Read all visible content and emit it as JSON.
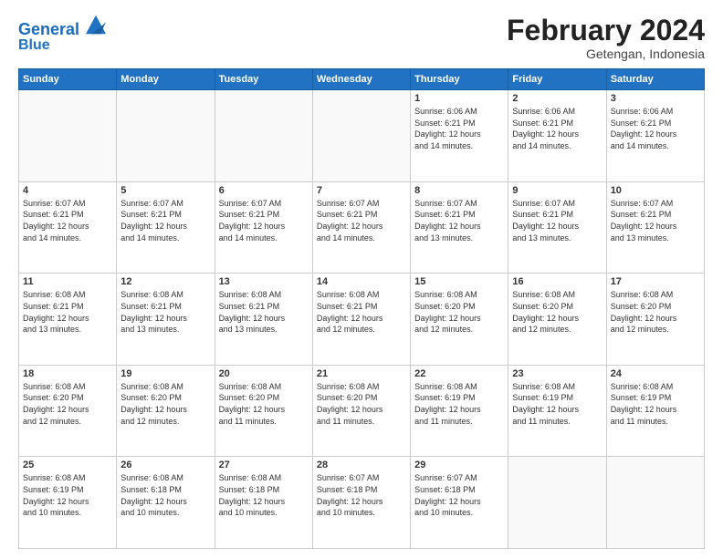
{
  "header": {
    "logo_line1": "General",
    "logo_line2": "Blue",
    "month_year": "February 2024",
    "location": "Getengan, Indonesia"
  },
  "days_of_week": [
    "Sunday",
    "Monday",
    "Tuesday",
    "Wednesday",
    "Thursday",
    "Friday",
    "Saturday"
  ],
  "weeks": [
    [
      {
        "day": "",
        "info": ""
      },
      {
        "day": "",
        "info": ""
      },
      {
        "day": "",
        "info": ""
      },
      {
        "day": "",
        "info": ""
      },
      {
        "day": "1",
        "info": "Sunrise: 6:06 AM\nSunset: 6:21 PM\nDaylight: 12 hours\nand 14 minutes."
      },
      {
        "day": "2",
        "info": "Sunrise: 6:06 AM\nSunset: 6:21 PM\nDaylight: 12 hours\nand 14 minutes."
      },
      {
        "day": "3",
        "info": "Sunrise: 6:06 AM\nSunset: 6:21 PM\nDaylight: 12 hours\nand 14 minutes."
      }
    ],
    [
      {
        "day": "4",
        "info": "Sunrise: 6:07 AM\nSunset: 6:21 PM\nDaylight: 12 hours\nand 14 minutes."
      },
      {
        "day": "5",
        "info": "Sunrise: 6:07 AM\nSunset: 6:21 PM\nDaylight: 12 hours\nand 14 minutes."
      },
      {
        "day": "6",
        "info": "Sunrise: 6:07 AM\nSunset: 6:21 PM\nDaylight: 12 hours\nand 14 minutes."
      },
      {
        "day": "7",
        "info": "Sunrise: 6:07 AM\nSunset: 6:21 PM\nDaylight: 12 hours\nand 14 minutes."
      },
      {
        "day": "8",
        "info": "Sunrise: 6:07 AM\nSunset: 6:21 PM\nDaylight: 12 hours\nand 13 minutes."
      },
      {
        "day": "9",
        "info": "Sunrise: 6:07 AM\nSunset: 6:21 PM\nDaylight: 12 hours\nand 13 minutes."
      },
      {
        "day": "10",
        "info": "Sunrise: 6:07 AM\nSunset: 6:21 PM\nDaylight: 12 hours\nand 13 minutes."
      }
    ],
    [
      {
        "day": "11",
        "info": "Sunrise: 6:08 AM\nSunset: 6:21 PM\nDaylight: 12 hours\nand 13 minutes."
      },
      {
        "day": "12",
        "info": "Sunrise: 6:08 AM\nSunset: 6:21 PM\nDaylight: 12 hours\nand 13 minutes."
      },
      {
        "day": "13",
        "info": "Sunrise: 6:08 AM\nSunset: 6:21 PM\nDaylight: 12 hours\nand 13 minutes."
      },
      {
        "day": "14",
        "info": "Sunrise: 6:08 AM\nSunset: 6:21 PM\nDaylight: 12 hours\nand 12 minutes."
      },
      {
        "day": "15",
        "info": "Sunrise: 6:08 AM\nSunset: 6:20 PM\nDaylight: 12 hours\nand 12 minutes."
      },
      {
        "day": "16",
        "info": "Sunrise: 6:08 AM\nSunset: 6:20 PM\nDaylight: 12 hours\nand 12 minutes."
      },
      {
        "day": "17",
        "info": "Sunrise: 6:08 AM\nSunset: 6:20 PM\nDaylight: 12 hours\nand 12 minutes."
      }
    ],
    [
      {
        "day": "18",
        "info": "Sunrise: 6:08 AM\nSunset: 6:20 PM\nDaylight: 12 hours\nand 12 minutes."
      },
      {
        "day": "19",
        "info": "Sunrise: 6:08 AM\nSunset: 6:20 PM\nDaylight: 12 hours\nand 12 minutes."
      },
      {
        "day": "20",
        "info": "Sunrise: 6:08 AM\nSunset: 6:20 PM\nDaylight: 12 hours\nand 11 minutes."
      },
      {
        "day": "21",
        "info": "Sunrise: 6:08 AM\nSunset: 6:20 PM\nDaylight: 12 hours\nand 11 minutes."
      },
      {
        "day": "22",
        "info": "Sunrise: 6:08 AM\nSunset: 6:19 PM\nDaylight: 12 hours\nand 11 minutes."
      },
      {
        "day": "23",
        "info": "Sunrise: 6:08 AM\nSunset: 6:19 PM\nDaylight: 12 hours\nand 11 minutes."
      },
      {
        "day": "24",
        "info": "Sunrise: 6:08 AM\nSunset: 6:19 PM\nDaylight: 12 hours\nand 11 minutes."
      }
    ],
    [
      {
        "day": "25",
        "info": "Sunrise: 6:08 AM\nSunset: 6:19 PM\nDaylight: 12 hours\nand 10 minutes."
      },
      {
        "day": "26",
        "info": "Sunrise: 6:08 AM\nSunset: 6:18 PM\nDaylight: 12 hours\nand 10 minutes."
      },
      {
        "day": "27",
        "info": "Sunrise: 6:08 AM\nSunset: 6:18 PM\nDaylight: 12 hours\nand 10 minutes."
      },
      {
        "day": "28",
        "info": "Sunrise: 6:07 AM\nSunset: 6:18 PM\nDaylight: 12 hours\nand 10 minutes."
      },
      {
        "day": "29",
        "info": "Sunrise: 6:07 AM\nSunset: 6:18 PM\nDaylight: 12 hours\nand 10 minutes."
      },
      {
        "day": "",
        "info": ""
      },
      {
        "day": "",
        "info": ""
      }
    ]
  ]
}
